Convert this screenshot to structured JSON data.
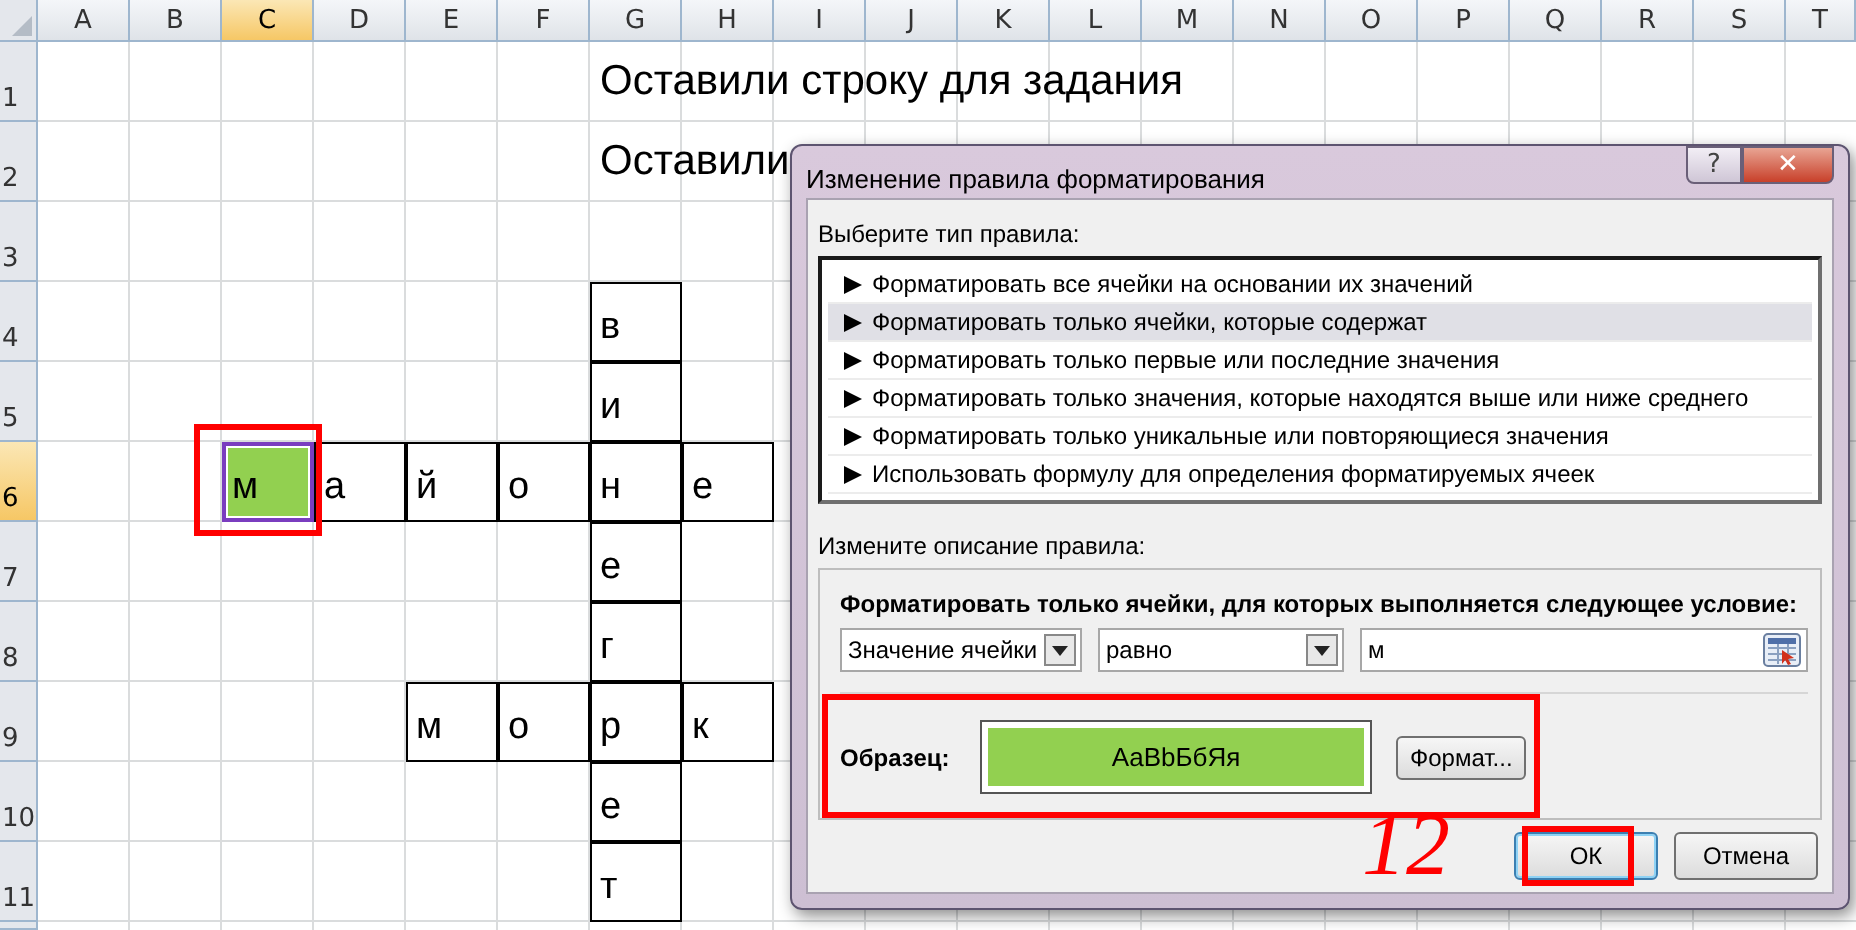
{
  "sheet": {
    "columns": [
      {
        "label": "A",
        "selected": false
      },
      {
        "label": "B",
        "selected": false
      },
      {
        "label": "C",
        "selected": true
      },
      {
        "label": "D",
        "selected": false
      },
      {
        "label": "E",
        "selected": false
      },
      {
        "label": "F",
        "selected": false
      },
      {
        "label": "G",
        "selected": false
      },
      {
        "label": "H",
        "selected": false
      },
      {
        "label": "I",
        "selected": false
      },
      {
        "label": "J",
        "selected": false
      },
      {
        "label": "K",
        "selected": false
      },
      {
        "label": "L",
        "selected": false
      },
      {
        "label": "M",
        "selected": false
      },
      {
        "label": "N",
        "selected": false
      },
      {
        "label": "O",
        "selected": false
      },
      {
        "label": "P",
        "selected": false
      },
      {
        "label": "Q",
        "selected": false
      },
      {
        "label": "R",
        "selected": false
      },
      {
        "label": "S",
        "selected": false
      },
      {
        "label": "T",
        "selected": false
      }
    ],
    "rows": [
      {
        "label": "1",
        "selected": false,
        "cells": [
          null,
          null,
          null,
          null,
          null,
          null,
          {
            "text": "Оставили строку для задания",
            "bordered": false,
            "selected": false,
            "formatted": false,
            "circled": false
          }
        ]
      },
      {
        "label": "2",
        "selected": false,
        "cells": [
          null,
          null,
          null,
          null,
          null,
          null,
          {
            "text": "Оставили",
            "bordered": false,
            "selected": false,
            "formatted": false,
            "circled": false
          }
        ]
      },
      {
        "label": "3",
        "selected": false
      },
      {
        "label": "4",
        "selected": false,
        "cells": [
          null,
          null,
          null,
          null,
          null,
          null,
          {
            "text": "в",
            "bordered": true,
            "selected": false,
            "formatted": false,
            "circled": false
          }
        ]
      },
      {
        "label": "5",
        "selected": false,
        "cells": [
          null,
          null,
          null,
          null,
          null,
          null,
          {
            "text": "и",
            "bordered": true,
            "selected": false,
            "formatted": false,
            "circled": false
          }
        ]
      },
      {
        "label": "6",
        "selected": true,
        "cells": [
          null,
          null,
          {
            "text": "м",
            "bordered": true,
            "selected": true,
            "formatted": true,
            "circled": true
          },
          {
            "text": "а",
            "bordered": true,
            "selected": false,
            "formatted": false,
            "circled": false
          },
          {
            "text": "й",
            "bordered": true,
            "selected": false,
            "formatted": false,
            "circled": false
          },
          {
            "text": "о",
            "bordered": true,
            "selected": false,
            "formatted": false,
            "circled": false
          },
          {
            "text": "н",
            "bordered": true,
            "selected": false,
            "formatted": false,
            "circled": false
          },
          {
            "text": "е",
            "bordered": true,
            "selected": false,
            "formatted": false,
            "circled": false
          }
        ]
      },
      {
        "label": "7",
        "selected": false,
        "cells": [
          null,
          null,
          null,
          null,
          null,
          null,
          {
            "text": "е",
            "bordered": true,
            "selected": false,
            "formatted": false,
            "circled": false
          }
        ]
      },
      {
        "label": "8",
        "selected": false,
        "cells": [
          null,
          null,
          null,
          null,
          null,
          null,
          {
            "text": "г",
            "bordered": true,
            "selected": false,
            "formatted": false,
            "circled": false
          }
        ]
      },
      {
        "label": "9",
        "selected": false,
        "cells": [
          null,
          null,
          null,
          null,
          {
            "text": "м",
            "bordered": true,
            "selected": false,
            "formatted": false,
            "circled": false
          },
          {
            "text": "о",
            "bordered": true,
            "selected": false,
            "formatted": false,
            "circled": false
          },
          {
            "text": "р",
            "bordered": true,
            "selected": false,
            "formatted": false,
            "circled": false
          },
          {
            "text": "к",
            "bordered": true,
            "selected": false,
            "formatted": false,
            "circled": false
          }
        ]
      },
      {
        "label": "10",
        "selected": false,
        "cells": [
          null,
          null,
          null,
          null,
          null,
          null,
          {
            "text": "е",
            "bordered": true,
            "selected": false,
            "formatted": false,
            "circled": false
          }
        ]
      },
      {
        "label": "11",
        "selected": false,
        "cells": [
          null,
          null,
          null,
          null,
          null,
          null,
          {
            "text": "т",
            "bordered": true,
            "selected": false,
            "formatted": false,
            "circled": false
          }
        ]
      }
    ]
  },
  "dialog": {
    "title": "Изменение правила форматирования",
    "title_buttons": [
      {
        "kind": "help",
        "label": "?"
      },
      {
        "kind": "close",
        "label": "✕"
      }
    ],
    "rule_type_label": "Выберите тип правила:",
    "rule_types": [
      {
        "label": "Форматировать все ячейки на основании их значений",
        "selected": false
      },
      {
        "label": "Форматировать только ячейки, которые содержат",
        "selected": true
      },
      {
        "label": "Форматировать только первые или последние значения",
        "selected": false
      },
      {
        "label": "Форматировать только значения, которые находятся выше или ниже среднего",
        "selected": false
      },
      {
        "label": "Форматировать только уникальные или повторяющиеся значения",
        "selected": false
      },
      {
        "label": "Использовать формулу для определения форматируемых ячеек",
        "selected": false
      }
    ],
    "description_label": "Измените описание правила:",
    "condition_heading": "Форматировать только ячейки, для которых выполняется следующее условие:",
    "condition": {
      "subject": "Значение ячейки",
      "operator": "равно",
      "value": "м"
    },
    "preview": {
      "label": "Образец:",
      "sample": "АаВbБбЯя",
      "format_button": "Формат...",
      "circled": true
    },
    "buttons": [
      {
        "label": "ОК",
        "default": true,
        "circled": true
      },
      {
        "label": "Отмена",
        "default": false,
        "circled": false
      }
    ],
    "handwritten_note": "12"
  }
}
